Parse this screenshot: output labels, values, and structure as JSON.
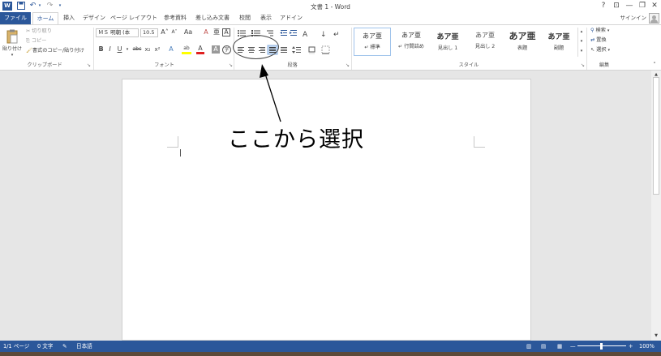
{
  "window": {
    "title": "文書 1 - Word",
    "help": "?",
    "restore_ribbon": "⊡",
    "minimize": "—",
    "maximize": "❐",
    "close": "✕"
  },
  "qat": [
    "word-logo",
    "save-icon",
    "undo-icon",
    "redo-icon",
    "customize-icon"
  ],
  "tabs": [
    {
      "label": "ファイル",
      "kind": "file"
    },
    {
      "label": "ホーム",
      "kind": "active"
    },
    {
      "label": "挿入"
    },
    {
      "label": "デザイン"
    },
    {
      "label": "ページ レイアウト"
    },
    {
      "label": "参考資料"
    },
    {
      "label": "差し込み文書"
    },
    {
      "label": "校閲"
    },
    {
      "label": "表示"
    },
    {
      "label": "アドイン"
    }
  ],
  "signin": "サインイン",
  "clipboard": {
    "paste": "貼り付け",
    "cut": "切り取り",
    "copy": "コピー",
    "format_painter": "書式のコピー/貼り付け",
    "label": "クリップボード"
  },
  "font": {
    "name": "ＭＳ 明朝 (本",
    "size": "10.5",
    "label": "フォント",
    "grow": "A˄",
    "shrink": "A˅",
    "case": "Aa",
    "clear": "A",
    "phonetic": "亜",
    "border_char": "A",
    "bold": "B",
    "italic": "I",
    "underline": "U",
    "strike": "abc",
    "subscript": "x₂",
    "superscript": "x²",
    "effects": "A",
    "highlight": "ab",
    "color": "A",
    "shade": "A",
    "enclose": "字"
  },
  "paragraph": {
    "label": "段落"
  },
  "styles": {
    "label": "スタイル",
    "items": [
      {
        "preview": "あア亜",
        "name": "↵ 標準"
      },
      {
        "preview": "あア亜",
        "name": "↵ 行間詰め"
      },
      {
        "preview": "あア亜",
        "name": "見出し 1"
      },
      {
        "preview": "あア亜",
        "name": "見出し 2"
      },
      {
        "preview": "あア亜",
        "name": "表題"
      },
      {
        "preview": "あア亜",
        "name": "副題"
      }
    ]
  },
  "editing": {
    "find": "検索",
    "replace": "置換",
    "select": "選択",
    "label": "編集"
  },
  "annotation": {
    "text": "ここから選択"
  },
  "status": {
    "page": "1/1 ページ",
    "words": "0 文字",
    "language": "日本語",
    "zoom": "100%"
  },
  "colors": {
    "accent": "#2b579a",
    "highlight": "#ffff00",
    "font_color": "#e02020"
  }
}
